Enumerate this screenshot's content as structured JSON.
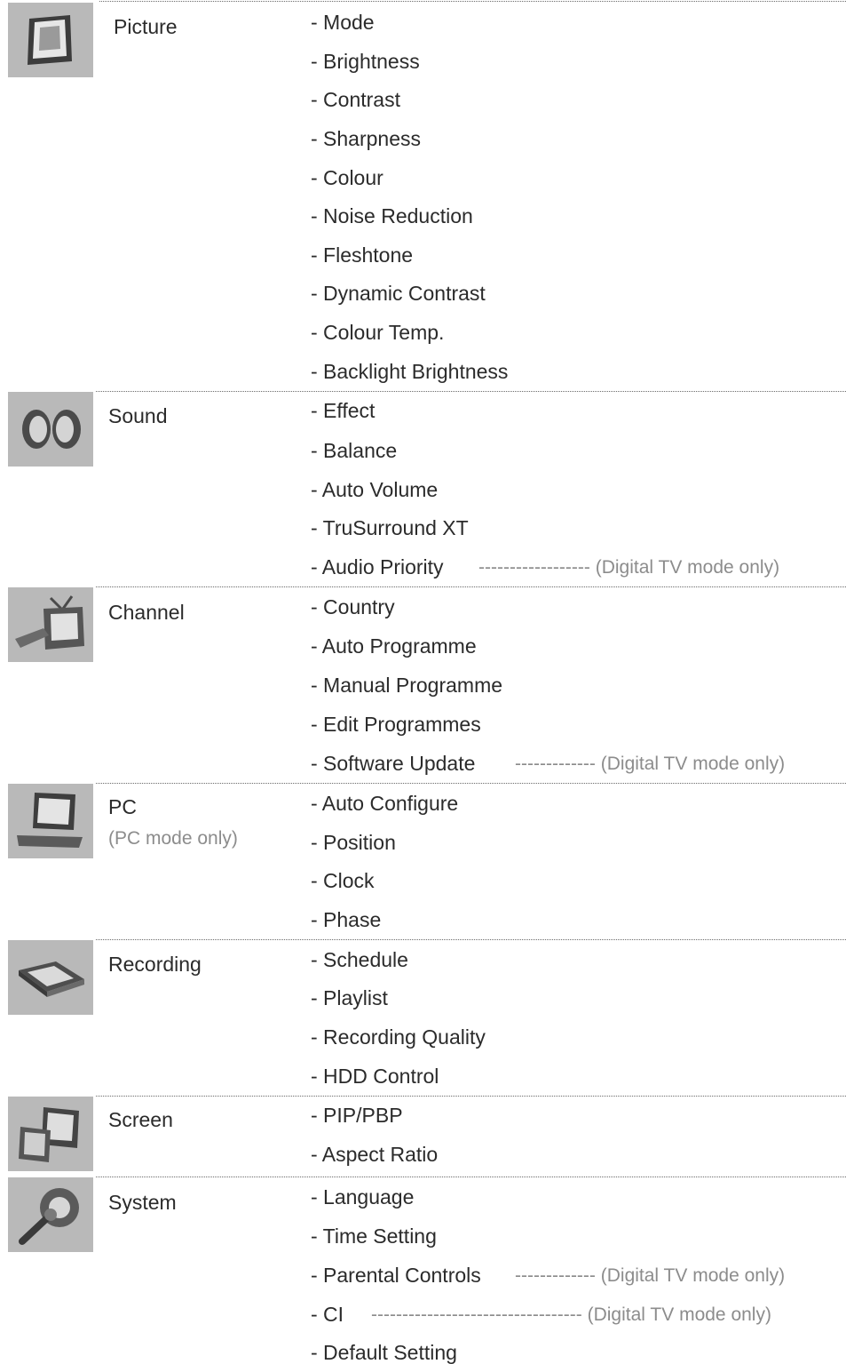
{
  "sections": [
    {
      "category": "Picture",
      "icon": "picture-frame-icon",
      "items": [
        "- Mode",
        "- Brightness",
        "- Contrast",
        "- Sharpness",
        "- Colour",
        "- Noise Reduction",
        "- Fleshtone",
        "- Dynamic Contrast",
        "- Colour Temp.",
        "- Backlight Brightness"
      ]
    },
    {
      "category": "Sound",
      "icon": "speakers-icon",
      "items": [
        "- Effect",
        "- Balance",
        "- Auto Volume",
        "- TruSurround XT",
        "- Audio Priority"
      ],
      "notes": [
        {
          "item_index": 4,
          "text": "------------------ (Digital TV mode only)"
        }
      ]
    },
    {
      "category": "Channel",
      "icon": "tv-remote-icon",
      "items": [
        "- Country",
        "- Auto Programme",
        "- Manual Programme",
        "- Edit Programmes",
        "- Software Update"
      ],
      "notes": [
        {
          "item_index": 4,
          "text": "------------- (Digital TV mode only)"
        }
      ]
    },
    {
      "category": "PC",
      "category_note": "(PC mode only)",
      "icon": "monitor-icon",
      "items": [
        "- Auto Configure",
        "- Position",
        "- Clock",
        "- Phase"
      ]
    },
    {
      "category": "Recording",
      "icon": "recorder-icon",
      "items": [
        "- Schedule",
        "- Playlist",
        "- Recording Quality",
        "- HDD Control"
      ]
    },
    {
      "category": "Screen",
      "icon": "screens-icon",
      "items": [
        "- PIP/PBP",
        "- Aspect Ratio"
      ]
    },
    {
      "category": "System",
      "icon": "wrench-gear-icon",
      "items": [
        "- Language",
        "- Time Setting",
        "- Parental Controls",
        "- CI",
        "- Default Setting"
      ],
      "notes": [
        {
          "item_index": 2,
          "text": "------------- (Digital TV mode only)"
        },
        {
          "item_index": 3,
          "text": "---------------------------------- (Digital TV mode only)"
        }
      ]
    }
  ]
}
